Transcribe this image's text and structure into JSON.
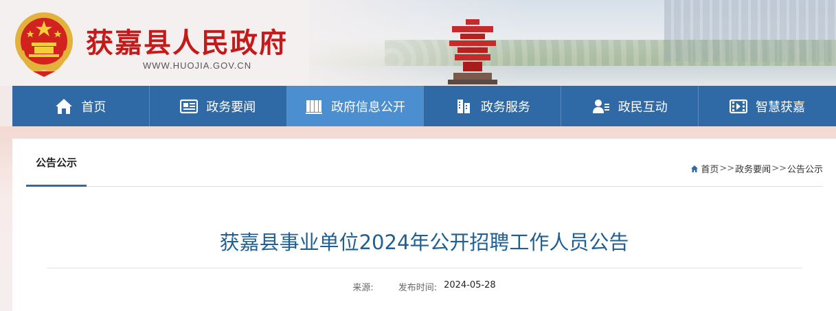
{
  "header": {
    "site_title": "获嘉县人民政府",
    "site_url": "WWW.HUOJIA.GOV.CN"
  },
  "nav": {
    "items": [
      {
        "label": "首页",
        "icon": "home-icon"
      },
      {
        "label": "政务要闻",
        "icon": "news-icon"
      },
      {
        "label": "政府信息公开",
        "icon": "books-icon",
        "active": true
      },
      {
        "label": "政务服务",
        "icon": "building-icon"
      },
      {
        "label": "政民互动",
        "icon": "user-chat-icon"
      },
      {
        "label": "智慧获嘉",
        "icon": "video-icon"
      }
    ]
  },
  "section": {
    "tab_title": "公告公示",
    "breadcrumb": {
      "home": "首页",
      "sep": ">>",
      "level1": "政务要闻",
      "level2": "公告公示"
    }
  },
  "article": {
    "title": "获嘉县事业单位2024年公开招聘工作人员公告",
    "source_label": "来源:",
    "date_label": "发布时间:",
    "date": "2024-05-28"
  },
  "colors": {
    "nav_bg": "#2f6aa6",
    "nav_active": "#4b8fd1",
    "title_red": "#c41a1a",
    "article_title": "#1f5f92"
  }
}
